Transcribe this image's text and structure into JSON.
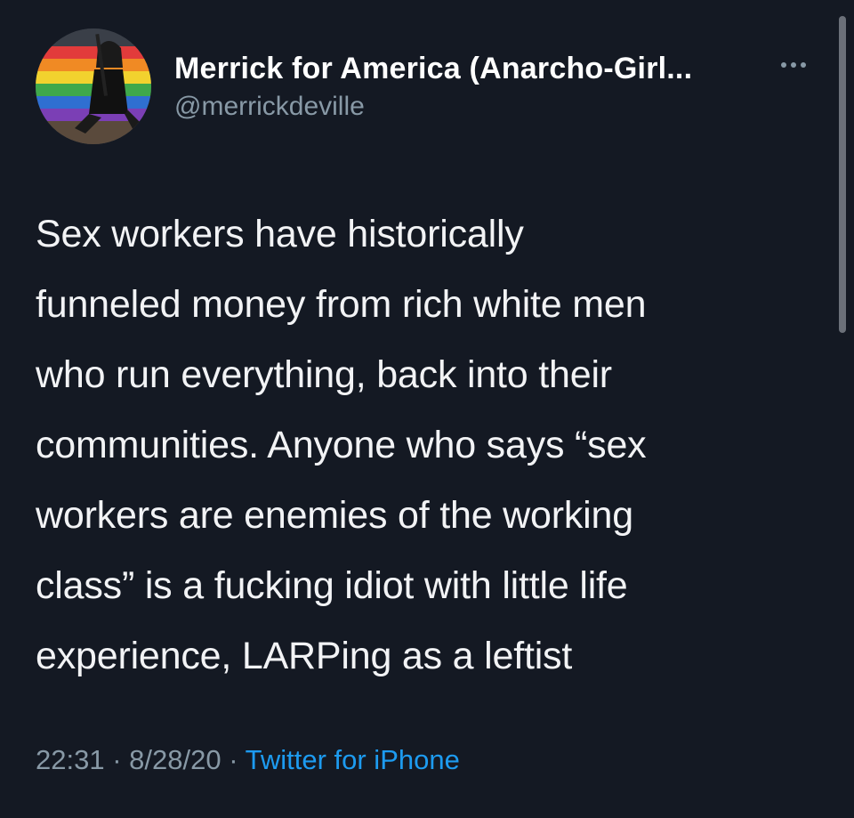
{
  "tweet": {
    "display_name": "Merrick for America (Anarcho-Girl...",
    "handle": "@merrickdeville",
    "more_icon": "more-options-icon",
    "text": "Sex workers have historically\nfunneled money from rich white men\nwho run everything, back into their\ncommunities. Anyone who says “sex\nworkers are enemies of the working\nclass” is a fucking idiot with little life\nexperience, LARPing as a leftist",
    "time": "22:31",
    "date": "8/28/20",
    "separator": "·",
    "source": "Twitter for iPhone"
  },
  "colors": {
    "background": "#141923",
    "text": "#f2f3f5",
    "secondary": "#8899a6",
    "link": "#1d9bf0"
  }
}
